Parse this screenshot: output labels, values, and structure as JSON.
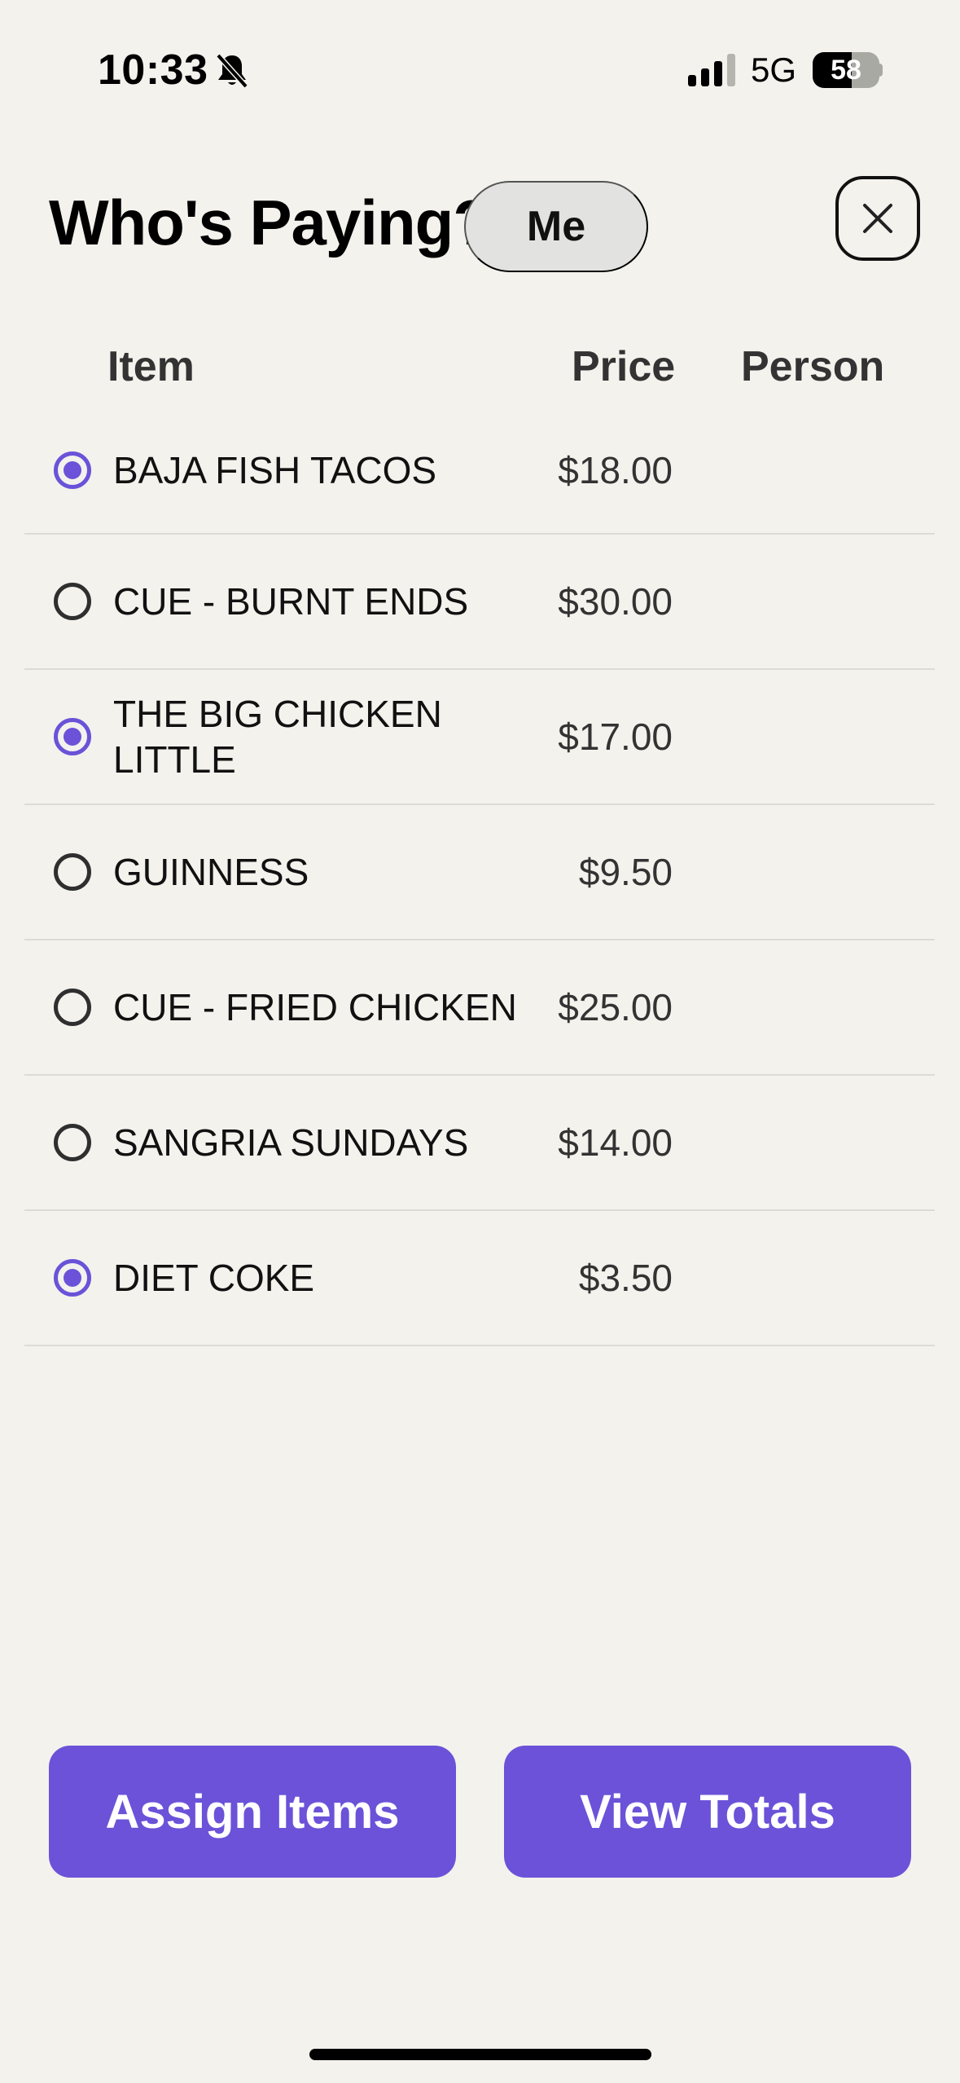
{
  "status_bar": {
    "time": "10:33",
    "network": "5G",
    "battery_percent": 58,
    "battery_label": "58",
    "bell_icon": "bell-slash-icon",
    "signal_icon": "cellular-signal-icon"
  },
  "header": {
    "title": "Who's Paying?",
    "payer": "Me",
    "close_icon": "close-icon"
  },
  "table": {
    "columns": {
      "item": "Item",
      "price": "Price",
      "person": "Person"
    },
    "rows": [
      {
        "name": "BAJA FISH TACOS",
        "price": "$18.00",
        "selected": true,
        "person": ""
      },
      {
        "name": "CUE - BURNT ENDS",
        "price": "$30.00",
        "selected": false,
        "person": ""
      },
      {
        "name": "THE BIG CHICKEN LITTLE",
        "price": "$17.00",
        "selected": true,
        "person": ""
      },
      {
        "name": "GUINNESS",
        "price": "$9.50",
        "selected": false,
        "person": ""
      },
      {
        "name": "CUE - FRIED CHICKEN",
        "price": "$25.00",
        "selected": false,
        "person": ""
      },
      {
        "name": "SANGRIA SUNDAYS",
        "price": "$14.00",
        "selected": false,
        "person": ""
      },
      {
        "name": "DIET COKE",
        "price": "$3.50",
        "selected": true,
        "person": ""
      }
    ]
  },
  "actions": {
    "assign_label": "Assign Items",
    "totals_label": "View Totals"
  },
  "colors": {
    "accent": "#6b52d8",
    "background": "#f3f2ed",
    "pill": "#e2e2e0"
  }
}
